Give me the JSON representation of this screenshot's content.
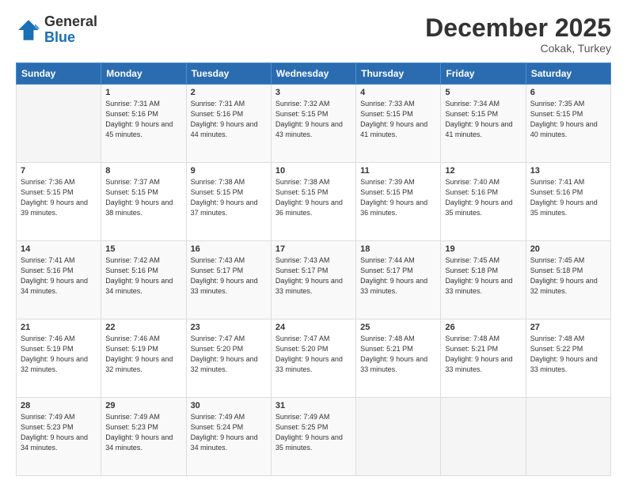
{
  "header": {
    "logo_line1": "General",
    "logo_line2": "Blue",
    "month": "December 2025",
    "location": "Cokak, Turkey"
  },
  "weekdays": [
    "Sunday",
    "Monday",
    "Tuesday",
    "Wednesday",
    "Thursday",
    "Friday",
    "Saturday"
  ],
  "weeks": [
    [
      {
        "day": "",
        "sunrise": "",
        "sunset": "",
        "daylight": ""
      },
      {
        "day": "1",
        "sunrise": "Sunrise: 7:31 AM",
        "sunset": "Sunset: 5:16 PM",
        "daylight": "Daylight: 9 hours and 45 minutes."
      },
      {
        "day": "2",
        "sunrise": "Sunrise: 7:31 AM",
        "sunset": "Sunset: 5:16 PM",
        "daylight": "Daylight: 9 hours and 44 minutes."
      },
      {
        "day": "3",
        "sunrise": "Sunrise: 7:32 AM",
        "sunset": "Sunset: 5:15 PM",
        "daylight": "Daylight: 9 hours and 43 minutes."
      },
      {
        "day": "4",
        "sunrise": "Sunrise: 7:33 AM",
        "sunset": "Sunset: 5:15 PM",
        "daylight": "Daylight: 9 hours and 41 minutes."
      },
      {
        "day": "5",
        "sunrise": "Sunrise: 7:34 AM",
        "sunset": "Sunset: 5:15 PM",
        "daylight": "Daylight: 9 hours and 41 minutes."
      },
      {
        "day": "6",
        "sunrise": "Sunrise: 7:35 AM",
        "sunset": "Sunset: 5:15 PM",
        "daylight": "Daylight: 9 hours and 40 minutes."
      }
    ],
    [
      {
        "day": "7",
        "sunrise": "Sunrise: 7:36 AM",
        "sunset": "Sunset: 5:15 PM",
        "daylight": "Daylight: 9 hours and 39 minutes."
      },
      {
        "day": "8",
        "sunrise": "Sunrise: 7:37 AM",
        "sunset": "Sunset: 5:15 PM",
        "daylight": "Daylight: 9 hours and 38 minutes."
      },
      {
        "day": "9",
        "sunrise": "Sunrise: 7:38 AM",
        "sunset": "Sunset: 5:15 PM",
        "daylight": "Daylight: 9 hours and 37 minutes."
      },
      {
        "day": "10",
        "sunrise": "Sunrise: 7:38 AM",
        "sunset": "Sunset: 5:15 PM",
        "daylight": "Daylight: 9 hours and 36 minutes."
      },
      {
        "day": "11",
        "sunrise": "Sunrise: 7:39 AM",
        "sunset": "Sunset: 5:15 PM",
        "daylight": "Daylight: 9 hours and 36 minutes."
      },
      {
        "day": "12",
        "sunrise": "Sunrise: 7:40 AM",
        "sunset": "Sunset: 5:16 PM",
        "daylight": "Daylight: 9 hours and 35 minutes."
      },
      {
        "day": "13",
        "sunrise": "Sunrise: 7:41 AM",
        "sunset": "Sunset: 5:16 PM",
        "daylight": "Daylight: 9 hours and 35 minutes."
      }
    ],
    [
      {
        "day": "14",
        "sunrise": "Sunrise: 7:41 AM",
        "sunset": "Sunset: 5:16 PM",
        "daylight": "Daylight: 9 hours and 34 minutes."
      },
      {
        "day": "15",
        "sunrise": "Sunrise: 7:42 AM",
        "sunset": "Sunset: 5:16 PM",
        "daylight": "Daylight: 9 hours and 34 minutes."
      },
      {
        "day": "16",
        "sunrise": "Sunrise: 7:43 AM",
        "sunset": "Sunset: 5:17 PM",
        "daylight": "Daylight: 9 hours and 33 minutes."
      },
      {
        "day": "17",
        "sunrise": "Sunrise: 7:43 AM",
        "sunset": "Sunset: 5:17 PM",
        "daylight": "Daylight: 9 hours and 33 minutes."
      },
      {
        "day": "18",
        "sunrise": "Sunrise: 7:44 AM",
        "sunset": "Sunset: 5:17 PM",
        "daylight": "Daylight: 9 hours and 33 minutes."
      },
      {
        "day": "19",
        "sunrise": "Sunrise: 7:45 AM",
        "sunset": "Sunset: 5:18 PM",
        "daylight": "Daylight: 9 hours and 33 minutes."
      },
      {
        "day": "20",
        "sunrise": "Sunrise: 7:45 AM",
        "sunset": "Sunset: 5:18 PM",
        "daylight": "Daylight: 9 hours and 32 minutes."
      }
    ],
    [
      {
        "day": "21",
        "sunrise": "Sunrise: 7:46 AM",
        "sunset": "Sunset: 5:19 PM",
        "daylight": "Daylight: 9 hours and 32 minutes."
      },
      {
        "day": "22",
        "sunrise": "Sunrise: 7:46 AM",
        "sunset": "Sunset: 5:19 PM",
        "daylight": "Daylight: 9 hours and 32 minutes."
      },
      {
        "day": "23",
        "sunrise": "Sunrise: 7:47 AM",
        "sunset": "Sunset: 5:20 PM",
        "daylight": "Daylight: 9 hours and 32 minutes."
      },
      {
        "day": "24",
        "sunrise": "Sunrise: 7:47 AM",
        "sunset": "Sunset: 5:20 PM",
        "daylight": "Daylight: 9 hours and 33 minutes."
      },
      {
        "day": "25",
        "sunrise": "Sunrise: 7:48 AM",
        "sunset": "Sunset: 5:21 PM",
        "daylight": "Daylight: 9 hours and 33 minutes."
      },
      {
        "day": "26",
        "sunrise": "Sunrise: 7:48 AM",
        "sunset": "Sunset: 5:21 PM",
        "daylight": "Daylight: 9 hours and 33 minutes."
      },
      {
        "day": "27",
        "sunrise": "Sunrise: 7:48 AM",
        "sunset": "Sunset: 5:22 PM",
        "daylight": "Daylight: 9 hours and 33 minutes."
      }
    ],
    [
      {
        "day": "28",
        "sunrise": "Sunrise: 7:49 AM",
        "sunset": "Sunset: 5:23 PM",
        "daylight": "Daylight: 9 hours and 34 minutes."
      },
      {
        "day": "29",
        "sunrise": "Sunrise: 7:49 AM",
        "sunset": "Sunset: 5:23 PM",
        "daylight": "Daylight: 9 hours and 34 minutes."
      },
      {
        "day": "30",
        "sunrise": "Sunrise: 7:49 AM",
        "sunset": "Sunset: 5:24 PM",
        "daylight": "Daylight: 9 hours and 34 minutes."
      },
      {
        "day": "31",
        "sunrise": "Sunrise: 7:49 AM",
        "sunset": "Sunset: 5:25 PM",
        "daylight": "Daylight: 9 hours and 35 minutes."
      },
      {
        "day": "",
        "sunrise": "",
        "sunset": "",
        "daylight": ""
      },
      {
        "day": "",
        "sunrise": "",
        "sunset": "",
        "daylight": ""
      },
      {
        "day": "",
        "sunrise": "",
        "sunset": "",
        "daylight": ""
      }
    ]
  ]
}
